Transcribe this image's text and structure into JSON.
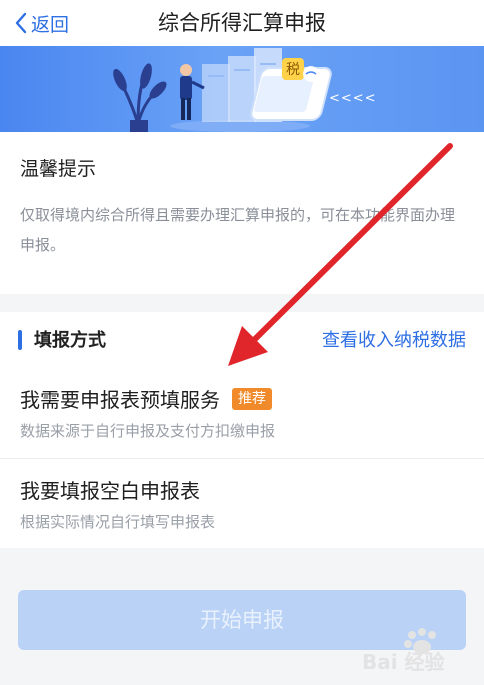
{
  "header": {
    "back_label": "返回",
    "title": "综合所得汇算申报"
  },
  "banner": {
    "tax_char": "税",
    "arrows": "<<<<"
  },
  "tips": {
    "title": "温馨提示",
    "body": "仅取得境内综合所得且需要办理汇算申报的，可在本功能界面办理申报。"
  },
  "method": {
    "section_title": "填报方式",
    "view_data_link": "查看收入纳税数据",
    "options": [
      {
        "label": "我需要申报表预填服务",
        "badge": "推荐",
        "desc": "数据来源于自行申报及支付方扣缴申报"
      },
      {
        "label": "我要填报空白申报表",
        "desc": "根据实际情况自行填写申报表"
      }
    ]
  },
  "start_button_label": "开始申报",
  "watermark": {
    "text": "Bai 经验",
    "brand_color": "#e3e3e3"
  },
  "colors": {
    "accent": "#2f6fe4",
    "badge": "#f08a2a",
    "annotation_arrow": "#e0252b",
    "button_disabled": "#b9d2f6"
  }
}
